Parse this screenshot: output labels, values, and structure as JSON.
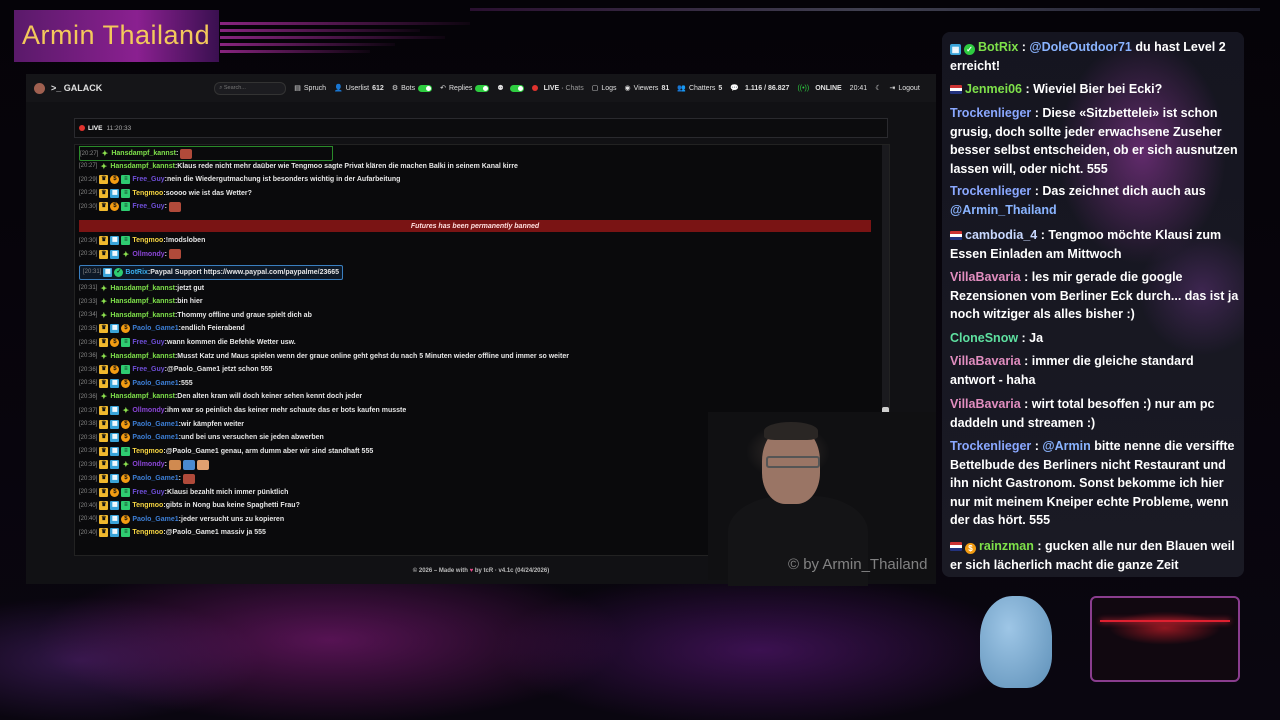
{
  "overlay_title": "Armin Thailand",
  "watermark": "© by Armin_Thailand",
  "nav": {
    "brand": ">_ GALACK",
    "search_placeholder": "Search...",
    "spruch": "Spruch",
    "userlist": "Userlist",
    "userlist_count": "612",
    "bots": "Bots",
    "replies": "Replies",
    "live": "LIVE",
    "chats": "Chats",
    "logs": "Logs",
    "viewers": "Viewers",
    "viewers_count": "81",
    "chatters": "Chatters",
    "chatters_count": "5",
    "messages": "1.116 / 86.827",
    "online": "ONLINE",
    "clock": "20:41",
    "logout": "Logout"
  },
  "live_bar": {
    "label": "LIVE",
    "time": "11:20:33"
  },
  "banned_notice": "Futures has been permanently banned",
  "footer": {
    "left": "© 2026 – Made with",
    "right": "by tcR · v4.1c (04/24/2026)"
  },
  "messages": [
    {
      "ts": "[20:27]",
      "user": "Hansdampf_kannst",
      "text": ""
    },
    {
      "ts": "[20:27]",
      "user": "Hansdampf_kannst",
      "text": "Klaus rede nicht mehr daüber wie Tengmoo sagte Privat klären die machen Balki in seinem Kanal kirre"
    },
    {
      "ts": "[20:29]",
      "user": "Free_Guy",
      "text": "nein die Wiedergutmachung ist besonders wichtig in der Aufarbeitung"
    },
    {
      "ts": "[20:29]",
      "user": "Tengmoo",
      "text": "soooo wie ist das Wetter?"
    },
    {
      "ts": "[20:30]",
      "user": "Free_Guy",
      "text": ""
    },
    {
      "ts": "[20:30]",
      "user": "Tengmoo",
      "text": "!modsloben"
    },
    {
      "ts": "[20:30]",
      "user": "Ollmondy",
      "text": ""
    },
    {
      "ts": "[20:31]",
      "user": "BotRix",
      "text": "Paypal Support https://www.paypal.com/paypalme/23665"
    },
    {
      "ts": "[20:31]",
      "user": "Hansdampf_kannst",
      "text": "jetzt gut"
    },
    {
      "ts": "[20:33]",
      "user": "Hansdampf_kannst",
      "text": "bin hier"
    },
    {
      "ts": "[20:34]",
      "user": "Hansdampf_kannst",
      "text": "Thommy offline und graue spielt dich ab"
    },
    {
      "ts": "[20:35]",
      "user": "Paolo_Game1",
      "text": "endlich Feierabend"
    },
    {
      "ts": "[20:36]",
      "user": "Free_Guy",
      "text": "wann kommen die Befehle Wetter usw."
    },
    {
      "ts": "[20:36]",
      "user": "Hansdampf_kannst",
      "text": "Musst Katz und Maus spielen wenn der graue online geht gehst du nach 5 Minuten wieder offline und immer so weiter"
    },
    {
      "ts": "[20:36]",
      "user": "Free_Guy",
      "text": "@Paolo_Game1 jetzt schon 555"
    },
    {
      "ts": "[20:36]",
      "user": "Paolo_Game1",
      "text": "555"
    },
    {
      "ts": "[20:36]",
      "user": "Hansdampf_kannst",
      "text": "Den alten kram will doch keiner sehen kennt doch jeder"
    },
    {
      "ts": "[20:37]",
      "user": "Ollmondy",
      "text": "ihm war so peinlich das keiner mehr schaute das er bots kaufen musste"
    },
    {
      "ts": "[20:38]",
      "user": "Paolo_Game1",
      "text": "wir kämpfen weiter"
    },
    {
      "ts": "[20:38]",
      "user": "Paolo_Game1",
      "text": "und bei uns versuchen sie jeden abwerben"
    },
    {
      "ts": "[20:39]",
      "user": "Tengmoo",
      "text": "@Paolo_Game1 genau, arm dumm aber wir sind standhaft 555"
    },
    {
      "ts": "[20:39]",
      "user": "Ollmondy",
      "text": ""
    },
    {
      "ts": "[20:39]",
      "user": "Paolo_Game1",
      "text": ""
    },
    {
      "ts": "[20:39]",
      "user": "Free_Guy",
      "text": "Klausi bezahlt mich immer pünktlich"
    },
    {
      "ts": "[20:40]",
      "user": "Tengmoo",
      "text": "gibts in Nong bua keine Spaghetti Frau?"
    },
    {
      "ts": "[20:40]",
      "user": "Paolo_Game1",
      "text": "jeder versucht uns zu kopieren"
    },
    {
      "ts": "[20:40]",
      "user": "Tengmoo",
      "text": "@Paolo_Game1 massiv ja 555"
    }
  ],
  "overlay_chat": [
    {
      "user": "BotRix",
      "mention": "@DoleOutdoor71",
      "text": "du hast Level 2 erreicht!"
    },
    {
      "user": "Jenmei06",
      "text": "Wieviel Bier bei Ecki?"
    },
    {
      "user": "Trockenlieger",
      "text": "Diese «Sitzbettelei» ist schon grusig, doch sollte jeder erwachsene Zuseher besser selbst entscheiden, ob er sich ausnutzen lassen will, oder nicht. 555"
    },
    {
      "user": "Trockenlieger",
      "text": "Das zeichnet dich auch aus",
      "mention": "@Armin_Thailand"
    },
    {
      "user": "cambodia_4",
      "text": "Tengmoo möchte Klausi zum Essen Einladen am Mittwoch"
    },
    {
      "user": "VillaBavaria",
      "text": "les mir gerade die google Rezensionen vom Berliner Eck durch... das ist ja noch witziger als alles bisher :)"
    },
    {
      "user": "CloneSnow",
      "text": "Ja"
    },
    {
      "user": "VillaBavaria",
      "text": "immer die gleiche standard antwort - haha"
    },
    {
      "user": "VillaBavaria",
      "text": "wirt total besoffen :) nur am pc daddeln und streamen :)"
    },
    {
      "user": "Trockenlieger",
      "mention": "@Armin",
      "text": "bitte nenne die versiffte Bettelbude des Berliners nicht Restaurant und ihn nicht Gastronom. Sonst bekomme ich hier nur mit meinem Kneiper echte Probleme, wenn der das hört. 555"
    },
    {
      "user": "rainzman",
      "text": "gucken alle nur den Blauen weil er sich lächerlich macht die ganze Zeit"
    }
  ]
}
